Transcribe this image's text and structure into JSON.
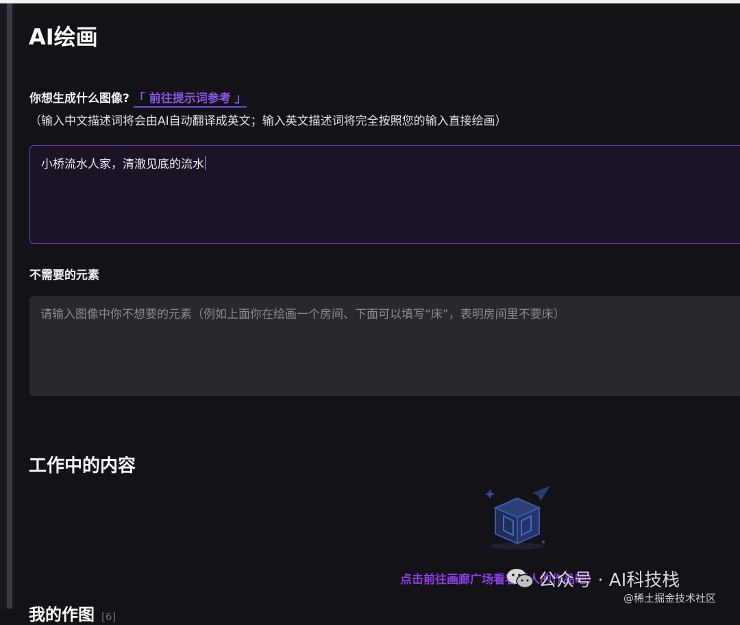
{
  "page": {
    "title": "AI绘画"
  },
  "prompt": {
    "label": "你想生成什么图像?",
    "reference_link": "「 前往提示词参考 」",
    "hint": "（输入中文描述词将会由AI自动翻译成英文；输入英文描述词将完全按照您的输入直接绘画）",
    "value": "小桥流水人家，清澈见底的流水"
  },
  "negative": {
    "label": "不需要的元素",
    "placeholder": "请输入图像中你不想要的元素（例如上面你在绘画一个房间、下面可以填写“床”，表明房间里不要床）"
  },
  "working": {
    "title": "工作中的内容",
    "empty_icon": "empty-box-icon",
    "gallery_link": "点击前往画廊广场看看别人的作品吧!"
  },
  "my_works": {
    "title": "我的作图",
    "count": "[6]"
  },
  "watermark": {
    "wechat": "公众号 · AI科技栈",
    "site": "@稀土掘金技术社区"
  },
  "colors": {
    "accent": "#8b54e6",
    "background": "#131217",
    "prompt_border": "#6b3fc2",
    "input_bg": "#29282e"
  }
}
